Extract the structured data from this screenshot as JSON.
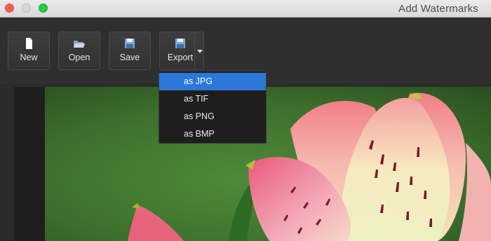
{
  "window": {
    "title": "Add Watermarks"
  },
  "toolbar": {
    "buttons": [
      {
        "label": "New",
        "icon": "new-document-icon"
      },
      {
        "label": "Open",
        "icon": "open-folder-icon"
      },
      {
        "label": "Save",
        "icon": "save-disk-icon"
      },
      {
        "label": "Export",
        "icon": "export-disk-icon"
      }
    ],
    "export_menu_toggle_icon": "chevron-down-icon"
  },
  "export_menu": {
    "items": [
      {
        "label": "as JPG",
        "selected": true
      },
      {
        "label": "as TIF",
        "selected": false
      },
      {
        "label": "as PNG",
        "selected": false
      },
      {
        "label": "as BMP",
        "selected": false
      }
    ]
  },
  "colors": {
    "selection": "#2b78d8",
    "close_light": "#fd5e57",
    "maximize_light": "#28c840"
  }
}
